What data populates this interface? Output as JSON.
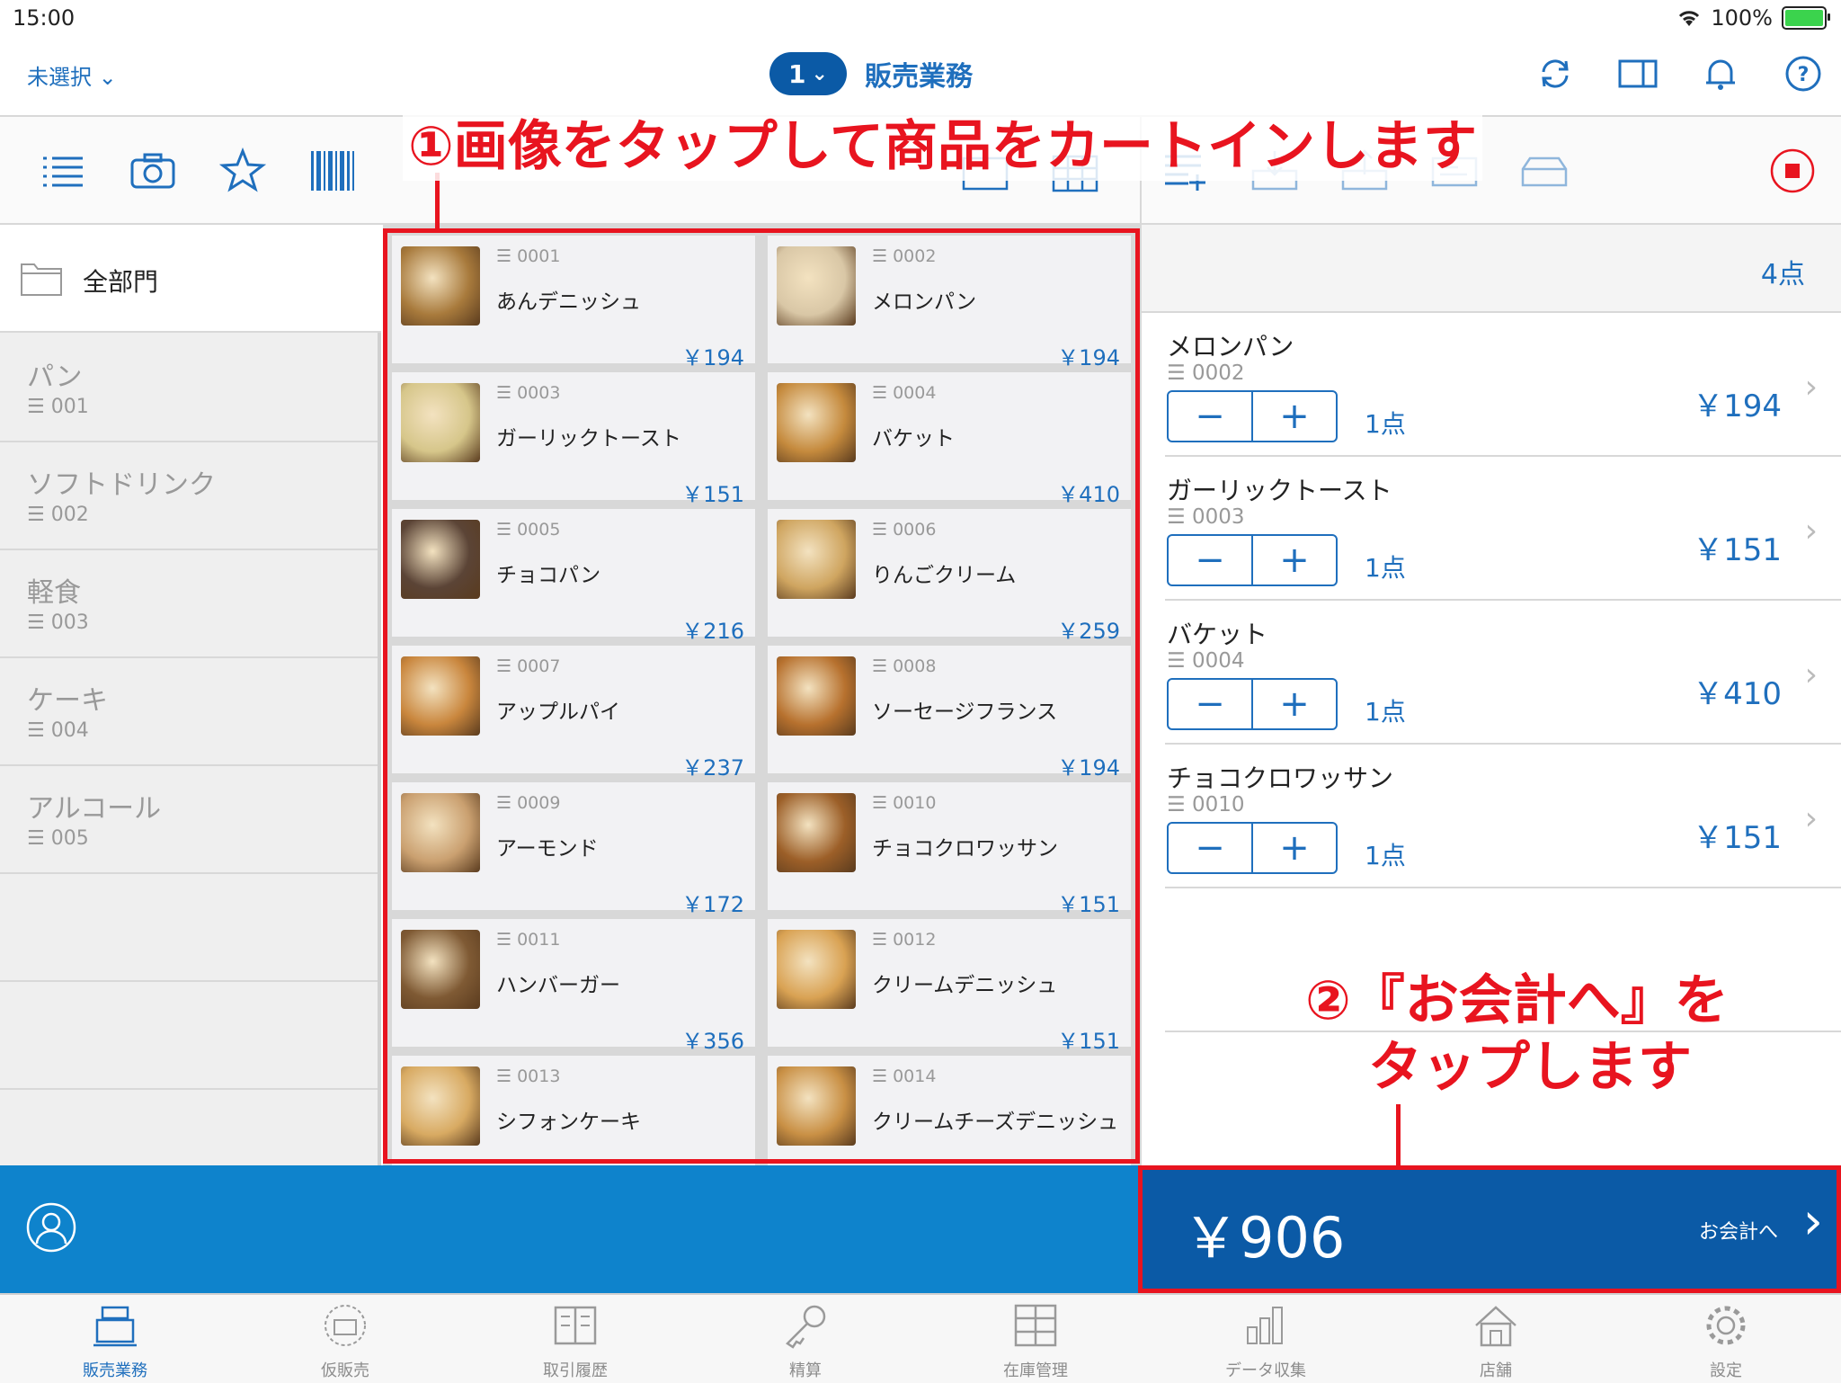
{
  "status": {
    "time": "15:00",
    "battery": "100%"
  },
  "nav": {
    "selector": "未選択",
    "register_no": "1",
    "title": "販売業務"
  },
  "categories": {
    "all": "全部門",
    "items": [
      {
        "name": "パン",
        "code": "001"
      },
      {
        "name": "ソフトドリンク",
        "code": "002"
      },
      {
        "name": "軽食",
        "code": "003"
      },
      {
        "name": "ケーキ",
        "code": "004"
      },
      {
        "name": "アルコール",
        "code": "005"
      }
    ]
  },
  "products": [
    {
      "code": "0001",
      "name": "あんデニッシュ",
      "price": "￥194",
      "color": "#a87a3c"
    },
    {
      "code": "0002",
      "name": "メロンパン",
      "price": "￥194",
      "color": "#d9c7a6"
    },
    {
      "code": "0003",
      "name": "ガーリックトースト",
      "price": "￥151",
      "color": "#d6c68a"
    },
    {
      "code": "0004",
      "name": "バケット",
      "price": "￥410",
      "color": "#c58a3d"
    },
    {
      "code": "0005",
      "name": "チョコパン",
      "price": "￥216",
      "color": "#5b4436"
    },
    {
      "code": "0006",
      "name": "りんごクリーム",
      "price": "￥259",
      "color": "#cfa560"
    },
    {
      "code": "0007",
      "name": "アップルパイ",
      "price": "￥237",
      "color": "#c9863d"
    },
    {
      "code": "0008",
      "name": "ソーセージフランス",
      "price": "￥194",
      "color": "#b7712e"
    },
    {
      "code": "0009",
      "name": "アーモンド",
      "price": "￥172",
      "color": "#caa070"
    },
    {
      "code": "0010",
      "name": "チョコクロワッサン",
      "price": "￥151",
      "color": "#9c5f28"
    },
    {
      "code": "0011",
      "name": "ハンバーガー",
      "price": "￥356",
      "color": "#7f5a34"
    },
    {
      "code": "0012",
      "name": "クリームデニッシュ",
      "price": "￥151",
      "color": "#d9a253"
    },
    {
      "code": "0013",
      "name": "シフォンケーキ",
      "price": "",
      "color": "#d8aa62"
    },
    {
      "code": "0014",
      "name": "クリームチーズデニッシュ",
      "price": "",
      "color": "#c99045"
    }
  ],
  "cart": {
    "count": "4点",
    "items": [
      {
        "name": "メロンパン",
        "code": "0002",
        "qty": "1点",
        "price": "￥194"
      },
      {
        "name": "ガーリックトースト",
        "code": "0003",
        "qty": "1点",
        "price": "￥151"
      },
      {
        "name": "バケット",
        "code": "0004",
        "qty": "1点",
        "price": "￥410"
      },
      {
        "name": "チョコクロワッサン",
        "code": "0010",
        "qty": "1点",
        "price": "￥151"
      }
    ],
    "total": "￥906",
    "checkout_label": "お会計へ"
  },
  "tabs": [
    "販売業務",
    "仮販売",
    "取引履歴",
    "精算",
    "在庫管理",
    "データ収集",
    "店舗",
    "設定"
  ],
  "annotations": {
    "top": "①画像をタップして商品をカートインします",
    "right_line1": "②『お会計へ』を",
    "right_line2": "タップします"
  },
  "colors": {
    "accent": "#1f6fbd",
    "checkout": "#0b5aa6",
    "bar": "#0e83cc",
    "annotation": "#e8141f"
  }
}
